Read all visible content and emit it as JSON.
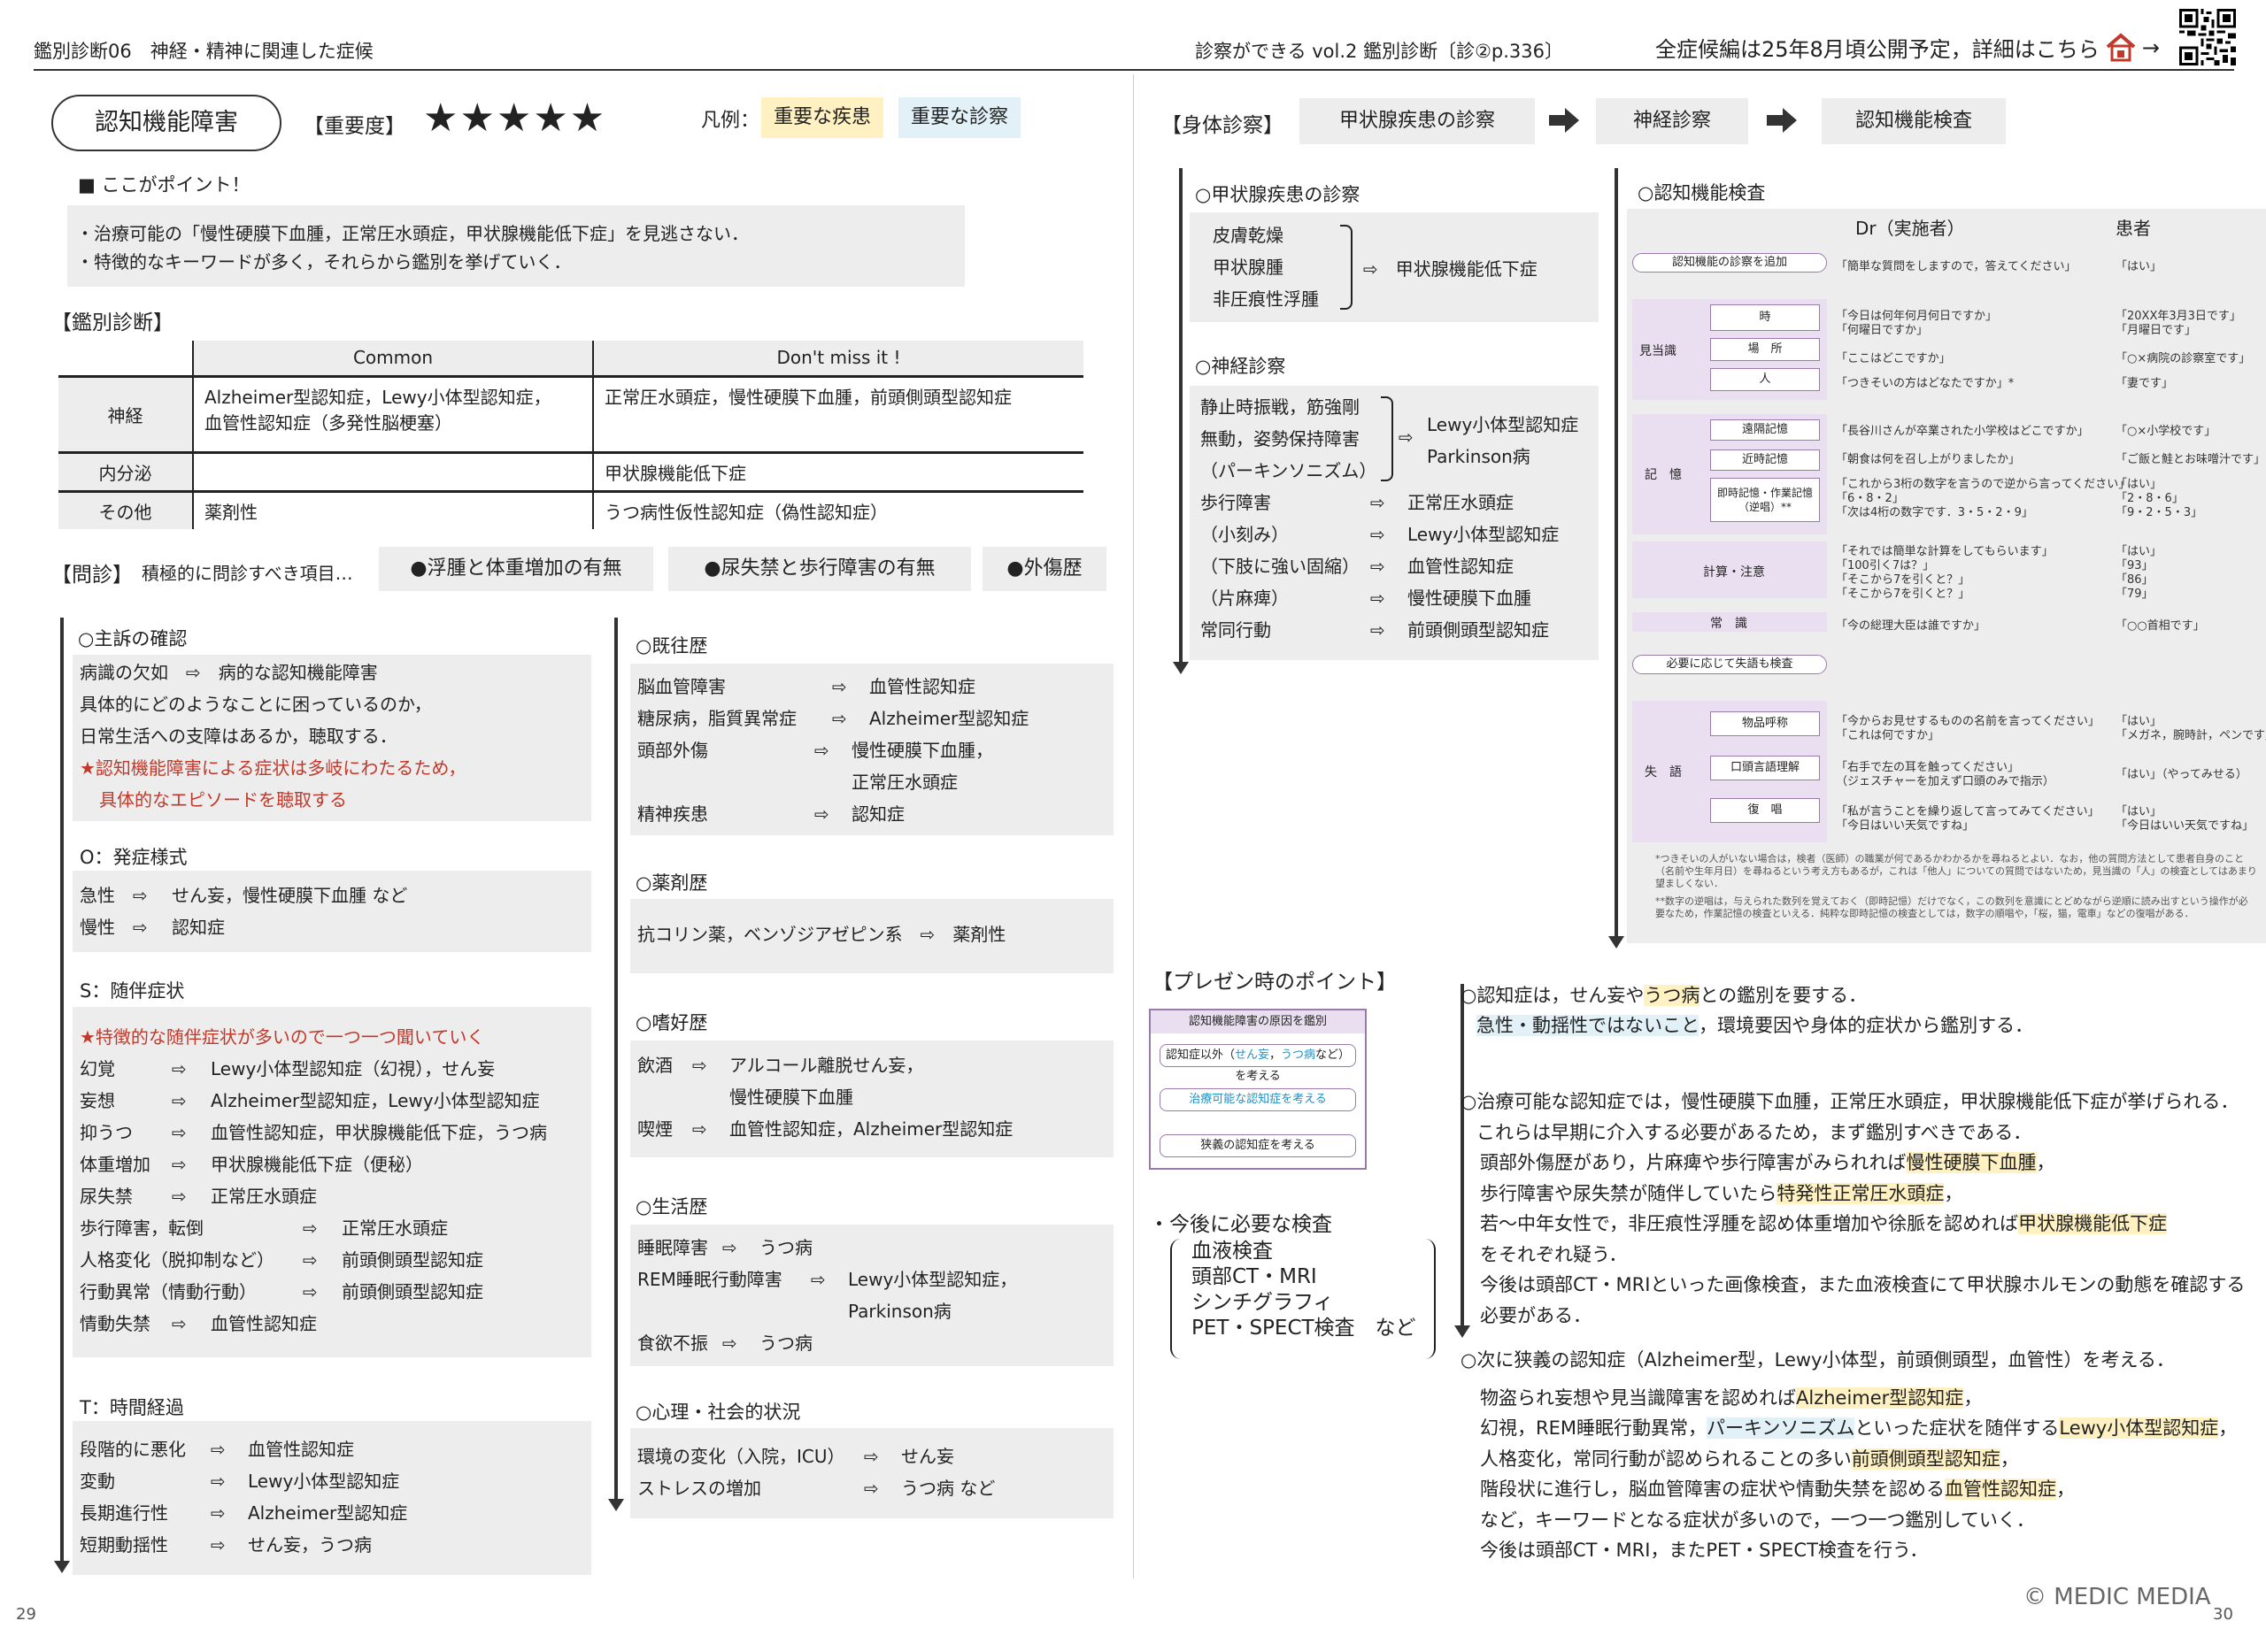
{
  "header": {
    "left": "鑑別診断06　神経・精神に関連した症候",
    "middle": "診察ができる vol.2 鑑別診断〔診②p.336〕",
    "right": "全症候編は25年8月頃公開予定，詳細はこちら",
    "arrow": "→"
  },
  "title": {
    "pill": "認知機能障害",
    "importance_label": "【重要度】",
    "stars": "★★★★★",
    "legend_label": "凡例：",
    "legend_disease": "重要な疾患",
    "legend_exam": "重要な診察"
  },
  "point": {
    "heading": "■ ここがポイント！",
    "lines": [
      "・治療可能の「慢性硬膜下血腫，正常圧水頭症，甲状腺機能低下症」を見逃さない．",
      "・特徴的なキーワードが多く，それらから鑑別を挙げていく．"
    ]
  },
  "ddx": {
    "heading": "【鑑別診断】",
    "columns": [
      "",
      "Common",
      "Don't miss it !"
    ],
    "rows": [
      {
        "label": "神経",
        "common": "Alzheimer型認知症，Lewy小体型認知症，\n血管性認知症（多発性脳梗塞）",
        "dont": "正常圧水頭症，慢性硬膜下血腫，前頭側頭型認知症"
      },
      {
        "label": "内分泌",
        "common": "",
        "dont": "甲状腺機能低下症"
      },
      {
        "label": "その他",
        "common": "薬剤性",
        "dont": "うつ病性仮性認知症（偽性認知症）"
      }
    ]
  },
  "history": {
    "heading": "【問診】",
    "sub": "積極的に問診すべき項目…",
    "tags": [
      "●浮腫と体重増加の有無",
      "●尿失禁と歩行障害の有無",
      "●外傷歴"
    ]
  },
  "chief": {
    "title": "○主訴の確認",
    "lines": [
      "病識の欠如　⇨　病的な認知機能障害",
      "具体的にどのようなことに困っているのか，",
      "日常生活への支障はあるか，聴取する．"
    ],
    "red1": "★認知機能障害による症状は多岐にわたるため，",
    "red2": "具体的なエピソードを聴取する"
  },
  "onset": {
    "title": "O：発症様式",
    "rows": [
      [
        "急性",
        "⇨",
        "せん妄，慢性硬膜下血腫 など"
      ],
      [
        "慢性",
        "⇨",
        "認知症"
      ]
    ]
  },
  "symptoms": {
    "title": "S：随伴症状",
    "red": "★特徴的な随伴症状が多いので一つ一つ聞いていく",
    "rows": [
      [
        "幻覚",
        "⇨",
        "Lewy小体型認知症（幻視），せん妄"
      ],
      [
        "妄想",
        "⇨",
        "Alzheimer型認知症，Lewy小体型認知症"
      ],
      [
        "抑うつ",
        "⇨",
        "血管性認知症，甲状腺機能低下症，うつ病"
      ],
      [
        "体重増加",
        "⇨",
        "甲状腺機能低下症（便秘）"
      ],
      [
        "尿失禁",
        "⇨",
        "正常圧水頭症"
      ],
      [
        "歩行障害，転倒",
        "⇨",
        "正常圧水頭症"
      ],
      [
        "人格変化（脱抑制など）",
        "⇨",
        "前頭側頭型認知症"
      ],
      [
        "行動異常（情動行動）",
        "⇨",
        "前頭側頭型認知症"
      ],
      [
        "情動失禁",
        "⇨",
        "血管性認知症"
      ]
    ]
  },
  "course": {
    "title": "T：時間経過",
    "rows": [
      [
        "段階的に悪化",
        "⇨",
        "血管性認知症"
      ],
      [
        "変動",
        "⇨",
        "Lewy小体型認知症"
      ],
      [
        "長期進行性",
        "⇨",
        "Alzheimer型認知症"
      ],
      [
        "短期動揺性",
        "⇨",
        "せん妄，うつ病"
      ]
    ]
  },
  "pmh": {
    "title": "○既往歴",
    "rows": [
      [
        "脳血管障害",
        "⇨",
        "血管性認知症"
      ],
      [
        "糖尿病，脂質異常症",
        "⇨",
        "Alzheimer型認知症"
      ],
      [
        "頭部外傷",
        "⇨",
        "慢性硬膜下血腫，"
      ],
      [
        "",
        "",
        "正常圧水頭症"
      ],
      [
        "精神疾患",
        "⇨",
        "認知症"
      ]
    ]
  },
  "drugs": {
    "title": "○薬剤歴",
    "line": "抗コリン薬，ベンゾジアゼピン系　⇨　薬剤性"
  },
  "habits": {
    "title": "○嗜好歴",
    "rows": [
      [
        "飲酒",
        "⇨",
        "アルコール離脱せん妄，"
      ],
      [
        "",
        "",
        "慢性硬膜下血腫"
      ],
      [
        "喫煙",
        "⇨",
        "血管性認知症，Alzheimer型認知症"
      ]
    ]
  },
  "life": {
    "title": "○生活歴",
    "rows": [
      [
        "睡眠障害",
        "⇨",
        "うつ病"
      ],
      [
        "REM睡眠行動障害",
        "⇨",
        "Lewy小体型認知症，"
      ],
      [
        "",
        "",
        "Parkinson病"
      ],
      [
        "食欲不振",
        "⇨",
        "うつ病"
      ]
    ]
  },
  "psycho": {
    "title": "○心理・社会的状況",
    "rows": [
      [
        "環境の変化（入院，ICU）",
        "⇨",
        "せん妄"
      ],
      [
        "ストレスの増加",
        "⇨",
        "うつ病 など"
      ]
    ]
  },
  "physical": {
    "heading": "【身体診察】",
    "steps": [
      "甲状腺疾患の診察",
      "神経診察",
      "認知機能検査"
    ]
  },
  "thyroid": {
    "title": "○甲状腺疾患の診察",
    "items": [
      "皮膚乾燥",
      "甲状腺腫",
      "非圧痕性浮腫"
    ],
    "result": "⇨　甲状腺機能低下症"
  },
  "neuro": {
    "title": "○神経診察",
    "group": [
      "静止時振戦，筋強剛",
      "無動，姿勢保持障害",
      "（パーキンソニズム）"
    ],
    "group_arrow": "⇨",
    "group_result": [
      "Lewy小体型認知症",
      "Parkinson病"
    ],
    "rows": [
      [
        "歩行障害",
        "⇨",
        "正常圧水頭症"
      ],
      [
        "（小刻み）",
        "⇨",
        "Lewy小体型認知症"
      ],
      [
        "（下肢に強い固縮）",
        "⇨",
        "血管性認知症"
      ],
      [
        "（片麻痺）",
        "⇨",
        "慢性硬膜下血腫"
      ],
      [
        "常同行動",
        "⇨",
        "前頭側頭型認知症"
      ]
    ]
  },
  "cog": {
    "title": "○認知機能検査",
    "col_dr": "Dr（実施者）",
    "col_pt": "患者",
    "start": "認知機能の診察を追加",
    "start_q": "「簡単な質問をしますので，答えてください」",
    "start_a": "「はい」",
    "orient": "見当識",
    "orient_items": [
      "時",
      "場　所",
      "人"
    ],
    "orient_q": [
      "「今日は何年何月何日ですか」",
      "「何曜日ですか」",
      "「ここはどこですか」",
      "「つきそいの方はどなたですか」*"
    ],
    "orient_a": [
      "「20XX年3月3日です」",
      "「月曜日です」",
      "「○×病院の診察室です」",
      "「妻です」"
    ],
    "memory": "記　憶",
    "memory_items": [
      "遠隔記憶",
      "近時記憶",
      "即時記憶・作業記憶（逆唱）**"
    ],
    "memory_q": [
      "「長谷川さんが卒業された小学校はどこですか」",
      "「朝食は何を召し上がりましたか」",
      "「これから3桁の数字を言うので逆から言ってください」",
      "「6・8・2」",
      "「次は4桁の数字です．3・5・2・9」"
    ],
    "memory_a": [
      "「○×小学校です」",
      "「ご飯と鮭とお味噌汁です」",
      "「はい」",
      "「2・8・6」",
      "「9・2・5・3」"
    ],
    "calc": "計算・注意",
    "calc_q": [
      "「それでは簡単な計算をしてもらいます」",
      "「100引く7は？」",
      "「そこから7を引くと？」",
      "「そこから7を引くと？」"
    ],
    "calc_a": [
      "「はい」",
      "「93」",
      "「86」",
      "「79」"
    ],
    "common": "常　識",
    "common_q": "「今の総理大臣は誰ですか」",
    "common_a": "「○○首相です」",
    "more": "必要に応じて失語も検査",
    "aphasia": "失　語",
    "aphasia_items": [
      "物品呼称",
      "口頭言語理解",
      "復　唱"
    ],
    "aphasia_q": [
      "「今からお見せするものの名前を言ってください」",
      "「これは何ですか」",
      "「右手で左の耳を触ってください」",
      "（ジェスチャーを加えず口頭のみで指示）",
      "「私が言うことを繰り返して言ってみてください」",
      "「今日はいい天気ですね」"
    ],
    "aphasia_a": [
      "「はい」",
      "「メガネ，腕時計，ペンです」",
      "「はい」（やってみせる）",
      "「はい」",
      "「今日はいい天気ですね」"
    ],
    "note1": "*つきそいの人がいない場合は，検者（医師）の職業が何であるかわかるかを尋ねるとよい．なお，他の質問方法として患者自身のこと（名前や生年月日）を尋ねるという考え方もあるが，これは「他人」についての質問ではないため，見当識の「人」の検査としてはあまり望ましくない．",
    "note2": "**数字の逆唱は，与えられた数列を覚えておく（即時記憶）だけでなく，この数列を意識にとどめながら逆順に読み出すという操作が必要なため，作業記憶の検査といえる．純粋な即時記憶の検査としては，数字の順唱や，「桜，猫，電車」などの復唱がある．"
  },
  "present": {
    "heading": "【プレゼン時のポイント】",
    "diag_title": "認知機能障害の原因を鑑別",
    "diag_1a": "認知症以外（",
    "diag_1b": "せん妄",
    "diag_1c": "，",
    "diag_1d": "うつ病",
    "diag_1e": "など）を考える",
    "diag_2": "治療可能な認知症を考える",
    "diag_3": "狭義の認知症を考える",
    "exam_heading": "・今後に必要な検査",
    "exams": [
      "血液検査",
      "頭部CT・MRI",
      "シンチグラフィ",
      "PET・SPECT検査　など"
    ]
  },
  "p1": {
    "a": "○認知症は，せん妄や",
    "hl": "うつ病",
    "b": "との鑑別を要する．",
    "line2a": "急性・動揺性ではないこと",
    "line2b": "，環境要因や身体的症状から鑑別する．"
  },
  "p2": {
    "line1": "○治療可能な認知症では，慢性硬膜下血腫，正常圧水頭症，甲状腺機能低下症が挙げられる．",
    "line2": "これらは早期に介入する必要があるため，まず鑑別すべきである．",
    "a1": "頭部外傷歴があり，片麻痺や歩行障害がみられれば",
    "a2": "慢性硬膜下血腫",
    "a3": "，",
    "b1": "歩行障害や尿失禁が随伴していたら",
    "b2": "特発性正常圧水頭症",
    "b3": "，",
    "c1": "若〜中年女性で，非圧痕性浮腫を認め体重増加や徐脈を認めれば",
    "c2": "甲状腺機能低下症",
    "d": "をそれぞれ疑う．",
    "e": "今後は頭部CT・MRIといった画像検査，また血液検査にて甲状腺ホルモンの動態を確認する",
    "f": "必要がある．"
  },
  "p3": {
    "line1": "○次に狭義の認知症（Alzheimer型，Lewy小体型，前頭側頭型，血管性）を考える．",
    "a1": "物盗られ妄想や見当識障害を認めれば",
    "a2": "Alzheimer型認知症",
    "a3": "，",
    "b1": "幻視，REM睡眠行動異常，",
    "b2": "パーキンソニズム",
    "b3": "といった症状を随伴する",
    "b4": "Lewy小体型認知症",
    "b5": "，",
    "c1": "人格変化，常同行動が認められることの多い",
    "c2": "前頭側頭型認知症",
    "c3": "，",
    "d1": "階段状に進行し，脳血管障害の症状や情動失禁を認める",
    "d2": "血管性認知症",
    "d3": "，",
    "e": "など，キーワードとなる症状が多いので，一つ一つ鑑別していく．",
    "f": "今後は頭部CT・MRI，またPET・SPECT検査を行う．"
  },
  "footer": {
    "page_left": "29",
    "copyright": "© MEDIC MEDIA",
    "page_right": "30"
  }
}
